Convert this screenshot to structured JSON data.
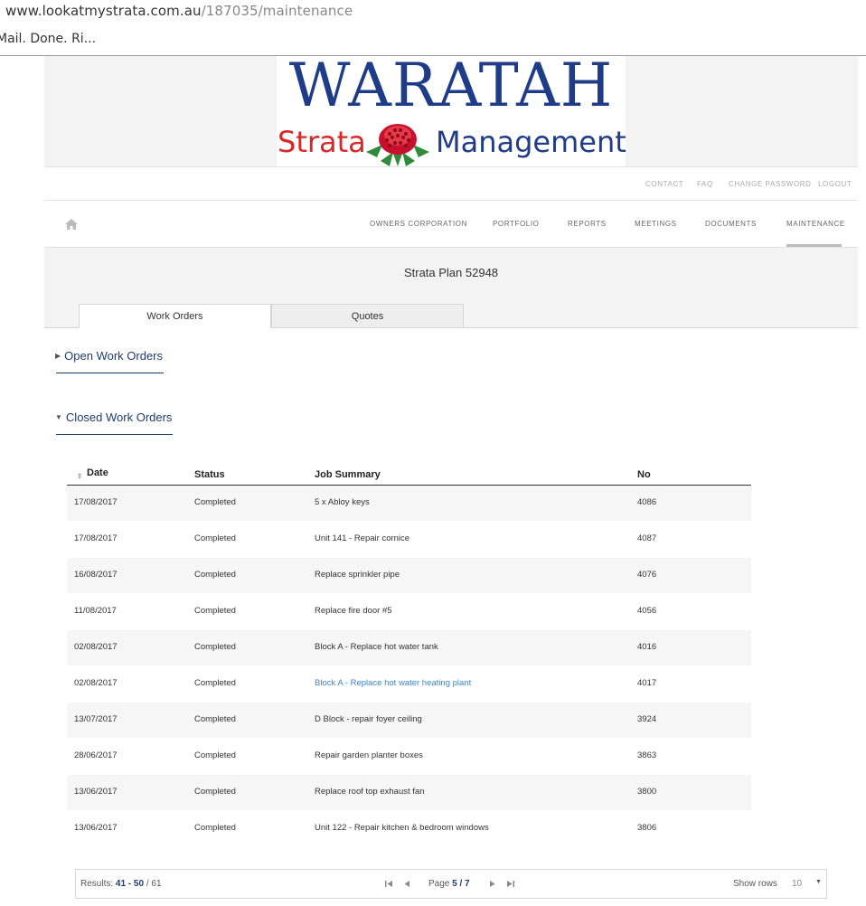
{
  "browser": {
    "url_host": "www.lookatmystrata.com.au",
    "url_path": "/187035/maintenance",
    "tab_title": "Mail. Done. Ri..."
  },
  "logo": {
    "line1": "WARATAH",
    "line2_left": "Strata",
    "line2_right": "Management"
  },
  "util_nav": [
    "CONTACT",
    "FAQ",
    "CHANGE PASSWORD",
    "LOGOUT"
  ],
  "main_nav": {
    "home_icon": "home-icon",
    "items": [
      "OWNERS CORPORATION",
      "PORTFOLIO",
      "REPORTS",
      "MEETINGS",
      "DOCUMENTS",
      "MAINTENANCE"
    ],
    "active": "MAINTENANCE"
  },
  "plan_title": "Strata Plan 52948",
  "tabs": [
    {
      "label": "Work Orders",
      "active": true
    },
    {
      "label": "Quotes",
      "active": false
    }
  ],
  "sections": {
    "open": {
      "label": "Open Work Orders",
      "expanded": false
    },
    "closed": {
      "label": "Closed Work Orders",
      "expanded": true
    }
  },
  "table": {
    "headers": [
      "Date",
      "Status",
      "Job Summary",
      "No"
    ],
    "rows": [
      {
        "date": "17/08/2017",
        "status": "Completed",
        "summary": "5 x Abloy keys",
        "no": "4086"
      },
      {
        "date": "17/08/2017",
        "status": "Completed",
        "summary": "Unit 141 - Repair cornice",
        "no": "4087"
      },
      {
        "date": "16/08/2017",
        "status": "Completed",
        "summary": "Replace sprinkler pipe",
        "no": "4076"
      },
      {
        "date": "11/08/2017",
        "status": "Completed",
        "summary": "Replace fire door #5",
        "no": "4056"
      },
      {
        "date": "02/08/2017",
        "status": "Completed",
        "summary": "Block A - Replace hot water tank",
        "no": "4016"
      },
      {
        "date": "02/08/2017",
        "status": "Completed",
        "summary": "Block A - Replace hot water heating plant",
        "no": "4017"
      },
      {
        "date": "13/07/2017",
        "status": "Completed",
        "summary": "D Block - repair foyer ceiling",
        "no": "3924"
      },
      {
        "date": "28/06/2017",
        "status": "Completed",
        "summary": "Repair garden planter boxes",
        "no": "3863"
      },
      {
        "date": "13/06/2017",
        "status": "Completed",
        "summary": "Replace roof top exhaust fan",
        "no": "3800"
      },
      {
        "date": "13/06/2017",
        "status": "Completed",
        "summary": "Unit 122 - Repair kitchen & bedroom windows",
        "no": "3806"
      }
    ]
  },
  "pager": {
    "results_label": "Results:",
    "results_range": "41 - 50",
    "results_sep": "/",
    "results_total": "61",
    "page_label": "Page",
    "page_current": "5 / 7",
    "rows_label": "Show rows",
    "rows_value": "10"
  },
  "colors": {
    "brand_blue": "#1f3c88",
    "brand_red": "#d62828",
    "link": "#3a86c8"
  }
}
